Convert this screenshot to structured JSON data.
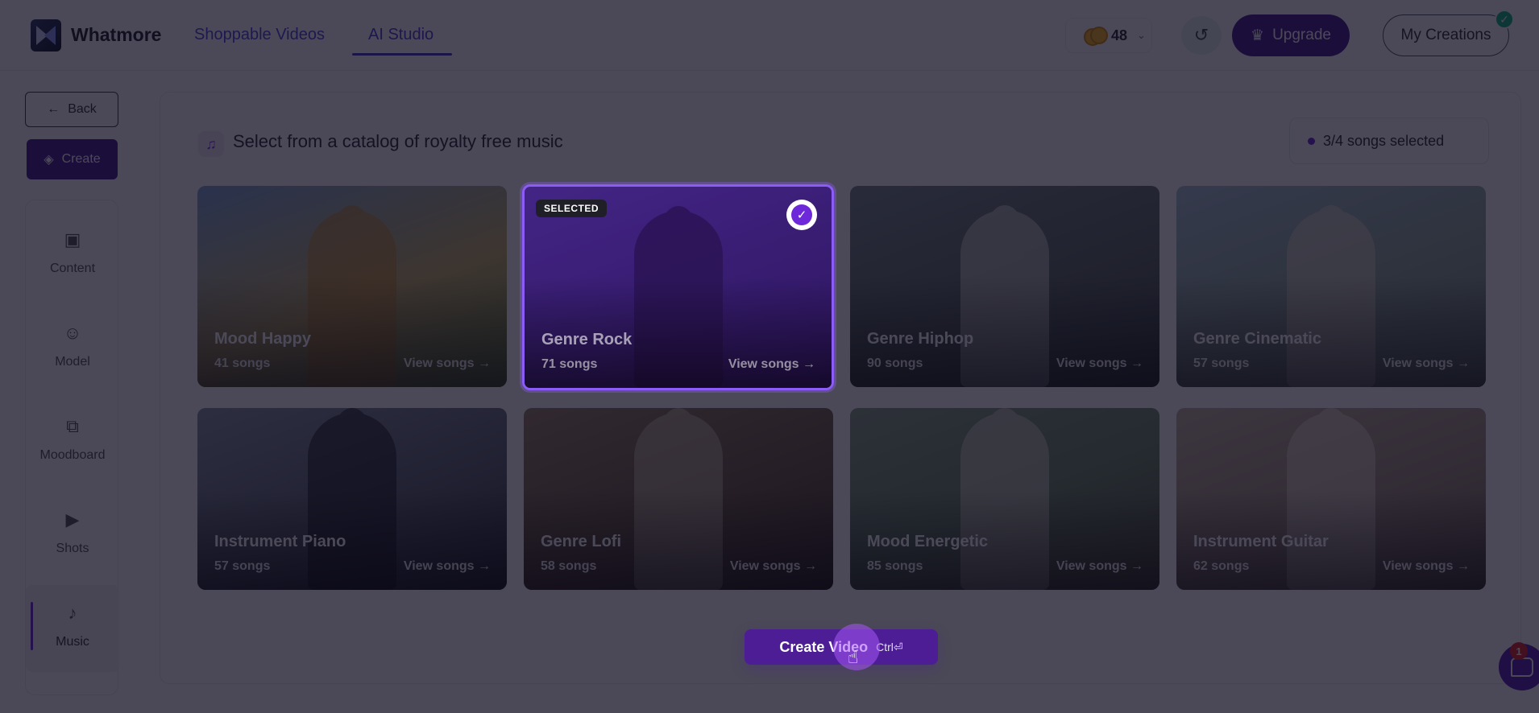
{
  "header": {
    "brand": "Whatmore",
    "nav": [
      {
        "label": "Shoppable Videos"
      },
      {
        "label": "AI Studio"
      }
    ],
    "credits": "48",
    "upgrade_label": "Upgrade",
    "creations_label": "My Creations"
  },
  "sidebar": {
    "back_label": "Back",
    "create_label": "Create",
    "items": [
      {
        "label": "Content",
        "icon": "image-icon"
      },
      {
        "label": "Model",
        "icon": "face-icon"
      },
      {
        "label": "Moodboard",
        "icon": "copy-icon"
      },
      {
        "label": "Shots",
        "icon": "play-icon"
      },
      {
        "label": "Music",
        "icon": "music-icon"
      }
    ]
  },
  "main": {
    "headline": "Select from a catalog of royalty free music",
    "selection_status": "3/4 songs selected",
    "selected_badge": "SELECTED",
    "view_label": "View songs →",
    "cards": [
      {
        "title": "Mood Happy",
        "count": "41 songs",
        "selected": false
      },
      {
        "title": "Genre Rock",
        "count": "71 songs",
        "selected": true
      },
      {
        "title": "Genre Hiphop",
        "count": "90 songs",
        "selected": false
      },
      {
        "title": "Genre Cinematic",
        "count": "57 songs",
        "selected": false
      },
      {
        "title": "Instrument Piano",
        "count": "57 songs",
        "selected": false
      },
      {
        "title": "Genre Lofi",
        "count": "58 songs",
        "selected": false
      },
      {
        "title": "Mood Energetic",
        "count": "85 songs",
        "selected": false
      },
      {
        "title": "Instrument Guitar",
        "count": "62 songs",
        "selected": false
      }
    ],
    "cta_label": "Create Video",
    "cta_shortcut": "Ctrl⏎"
  },
  "chat": {
    "badge": "1"
  },
  "colors": {
    "accent": "#4c1d95",
    "selected_border": "#8b5cf6",
    "overlay": "#0c0a1c"
  }
}
